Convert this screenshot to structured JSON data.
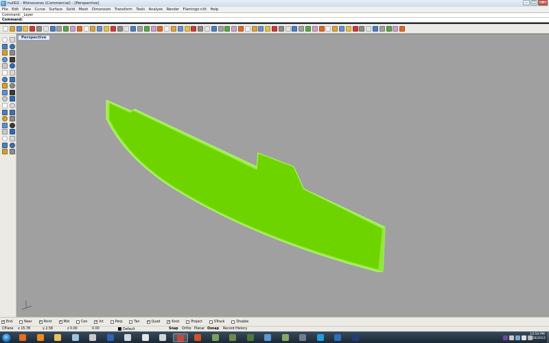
{
  "window": {
    "title": "hull02 - Rhinoceros (Commercial) - [Perspective]",
    "controls": {
      "minimize": "–",
      "maximize": "□",
      "close": "✕"
    }
  },
  "menu": [
    "File",
    "Edit",
    "View",
    "Curve",
    "Surface",
    "Solid",
    "Mesh",
    "Dimension",
    "Transform",
    "Tools",
    "Analyze",
    "Render",
    "Flamingo nXt",
    "Help"
  ],
  "command": {
    "history": "Command: _Layer",
    "prompt": "Command:",
    "value": ""
  },
  "viewport": {
    "label": "Perspective",
    "background": "#a0a0a0",
    "object_color": "#6dd400",
    "object_edge_color": "#9cf04a"
  },
  "osnap": [
    {
      "label": "End",
      "checked": true
    },
    {
      "label": "Near",
      "checked": false
    },
    {
      "label": "Point",
      "checked": true
    },
    {
      "label": "Mid",
      "checked": true
    },
    {
      "label": "Cen",
      "checked": false
    },
    {
      "label": "Int",
      "checked": true
    },
    {
      "label": "Perp",
      "checked": false
    },
    {
      "label": "Tan",
      "checked": false
    },
    {
      "label": "Quad",
      "checked": true
    },
    {
      "label": "Knot",
      "checked": true
    },
    {
      "label": "Project",
      "checked": false
    },
    {
      "label": "STrack",
      "checked": false
    },
    {
      "label": "Disable",
      "checked": false
    }
  ],
  "status": {
    "cplane": "CPlane",
    "x": "x 15.78",
    "y": "y 2.58",
    "z": "z 0.00",
    "num": "0.00",
    "layer": "Default",
    "snap": "Snap",
    "ortho": "Ortho",
    "planar": "Planar",
    "osnap": "Osnap",
    "history": "Record History"
  },
  "taskbar": {
    "time": "10:50 PM",
    "date": "7/26/2012",
    "apps": [
      {
        "name": "firefox",
        "color": "#e86b1f"
      },
      {
        "name": "media-player",
        "color": "#f28b1e"
      },
      {
        "name": "explorer",
        "color": "#e9c45a"
      },
      {
        "name": "rhino",
        "color": "#9fc4e0"
      },
      {
        "name": "settings",
        "color": "#c9c9c9"
      },
      {
        "name": "photoshop",
        "color": "#2a66b8"
      },
      {
        "name": "app-x",
        "color": "#cfd8e3"
      },
      {
        "name": "app-flower",
        "color": "#e6e6e6"
      },
      {
        "name": "app-z",
        "color": "#d5d5d5"
      },
      {
        "name": "rhino-active",
        "color": "#c44a3a"
      },
      {
        "name": "powerpoint",
        "color": "#d0512a"
      },
      {
        "name": "map",
        "color": "#7aa35a"
      },
      {
        "name": "photo-1",
        "color": "#6e8a4a"
      },
      {
        "name": "photo-2",
        "color": "#4d7a3a"
      },
      {
        "name": "browser",
        "color": "#5a9ad5"
      },
      {
        "name": "photo-3",
        "color": "#8aa865"
      },
      {
        "name": "photo-4",
        "color": "#6f7f8f"
      },
      {
        "name": "skype",
        "color": "#1ea0e0"
      },
      {
        "name": "app-blue",
        "color": "#2c6fbf"
      },
      {
        "name": "eye-app",
        "color": "#1e3d7a"
      }
    ]
  }
}
